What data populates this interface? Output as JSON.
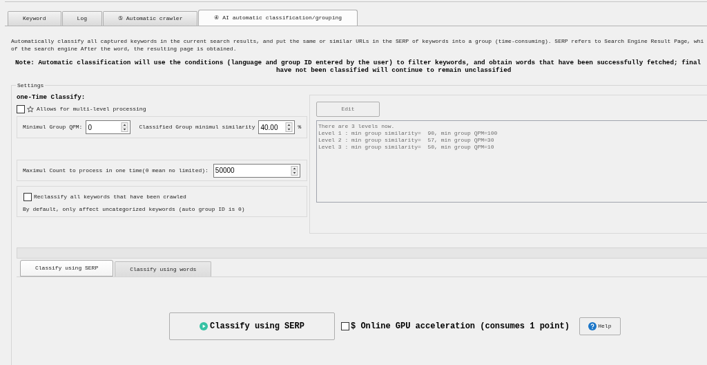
{
  "tabs": [
    {
      "label": "Keyword",
      "selected": false
    },
    {
      "label": "Log",
      "selected": false
    },
    {
      "label": "⑤ Automatic crawler",
      "selected": false
    },
    {
      "label": "④ AI automatic classification/grouping",
      "selected": true
    }
  ],
  "description": [
    "Automatically classify all captured keywords in the current search results, and put the same or similar URLs in the SERP of keywords into a group (time-consuming). SERP refers to Search Engine Result Page, whi",
    "of the search engine After the word, the resulting page is obtained."
  ],
  "note": [
    "Note: Automatic classification will use the conditions (language and group ID entered by the user) to filter keywords, and obtain words that have been successfully fetched; final",
    "have not been classified will continue to remain unclassified"
  ],
  "settings": {
    "title": "Settings",
    "heading": "one-Time Classify:",
    "multi_level": {
      "label": "Allows for multi-level processing",
      "checked": false
    },
    "min_group_qpm": {
      "label": "Minimul Group QPM:",
      "value": "0"
    },
    "min_similarity": {
      "label": "Classified Group minimul similarity",
      "value": "40.00",
      "unit": "%"
    },
    "max_count": {
      "label": "Maximul Count to process in one time(0 mean no limited):",
      "value": "50000"
    },
    "reclassify": {
      "label": "Reclassify all keywords that have been crawled",
      "checked": false,
      "hint": "By default, only affect uncategorized keywords (auto group ID is 0)"
    },
    "levels": {
      "disabled": true,
      "edit_button": "Edit",
      "lines": [
        "There are 3 levels now.",
        "Level 1 : min group similarity=  90, min group QPM=100",
        "Level 2 : min group similarity=  57, min group QPM=30",
        "Level 3 : min group similarity=  50, min group QPM=10"
      ]
    }
  },
  "method_tabs": [
    {
      "label": "Classify using SERP",
      "selected": true
    },
    {
      "label": "Classify using words",
      "selected": false
    }
  ],
  "run_button": "Classify using SERP",
  "gpu_option": {
    "label": "$ Online GPU acceleration (consumes 1 point)",
    "checked": false
  },
  "help_button": "Help"
}
